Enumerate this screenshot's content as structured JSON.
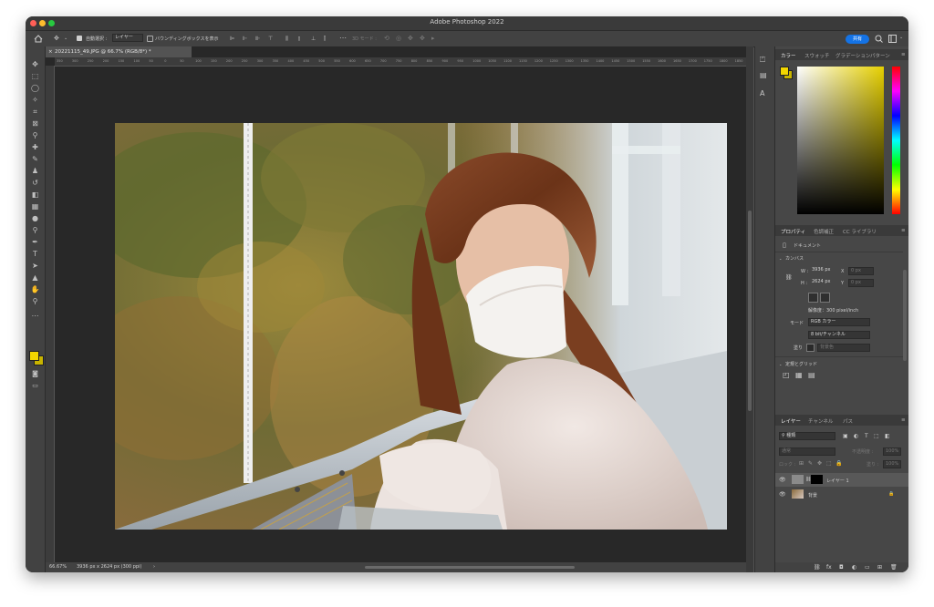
{
  "window": {
    "title": "Adobe Photoshop 2022"
  },
  "options_bar": {
    "auto_select_label": "自動選択 :",
    "auto_select_value": "レイヤー",
    "bounding_box_label": "バウンディングボックスを表示",
    "mode_3d_label": "3D モード :",
    "share_label": "共有"
  },
  "document": {
    "tab_title": "20221115_49.JPG @ 66.7% (RGB/8*) *",
    "close_glyph": "×",
    "ruler_marks": [
      "350",
      "300",
      "250",
      "200",
      "150",
      "100",
      "50",
      "0",
      "50",
      "100",
      "150",
      "200",
      "250",
      "300",
      "350",
      "400",
      "450",
      "500",
      "550",
      "600",
      "650",
      "700",
      "750",
      "800",
      "850",
      "900",
      "950",
      "1000",
      "1050",
      "1100",
      "1150",
      "1200",
      "1250",
      "1300",
      "1350",
      "1400",
      "1450",
      "1500",
      "1550",
      "1600",
      "1650",
      "1700",
      "1750",
      "1800",
      "1850",
      "1900",
      "1950",
      "2000",
      "2050",
      "2100",
      "2150",
      "2200",
      "2250",
      "2300",
      "2350",
      "2400",
      "2450",
      "2500",
      "2550",
      "2600",
      "2650",
      "2700",
      "2750",
      "2800",
      "2850",
      "2900",
      "2950",
      "3000",
      "3050",
      "3100",
      "3150",
      "3200",
      "3250",
      "3300",
      "3350",
      "3400",
      "3450",
      "3500",
      "3550",
      "3600",
      "3650",
      "3700",
      "3750",
      "3800",
      "3850",
      "3900",
      "3950",
      "4000",
      "4050",
      "4100",
      "4150",
      "4200"
    ],
    "zoom": "66.67%",
    "doc_info": "3936 px x 2624 px (300 ppi)",
    "status_arrow": "›"
  },
  "panels": {
    "color_tabs": [
      "カラー",
      "スウォッチ",
      "グラデーション",
      "パターン"
    ],
    "properties_tabs": [
      "プロパティ",
      "色調補正",
      "CC ライブラリ"
    ],
    "properties": {
      "doc_label": "ドキュメント",
      "canvas_label": "カンバス",
      "w_label": "W :",
      "w_value": "3936 px",
      "h_label": "H :",
      "h_value": "2624 px",
      "x_label": "X",
      "x_value": "0 px",
      "y_label": "Y",
      "y_value": "0 px",
      "resolution": "解像度：300 pixel/inch",
      "mode_label": "モード",
      "mode_value": "RGB カラー",
      "bit_value": "8 bit/チャンネル",
      "fill_label": "塗り",
      "fill_value": "背景色",
      "rulers_grids_label": "定規とグリッド"
    },
    "layers_tabs": [
      "レイヤー",
      "チャンネル",
      "パス"
    ],
    "layers": {
      "filter_label": "種類",
      "blend_mode": "通常",
      "opacity_label": "不透明度 :",
      "opacity_value": "100%",
      "lock_label": "ロック :",
      "fill_label": "塗り :",
      "fill_value": "100%",
      "items": [
        {
          "name": "レイヤー 1"
        },
        {
          "name": "背景"
        }
      ]
    }
  },
  "colors": {
    "foreground": "#f2d600",
    "background": "#c8b400",
    "accent": "#1473e6"
  }
}
